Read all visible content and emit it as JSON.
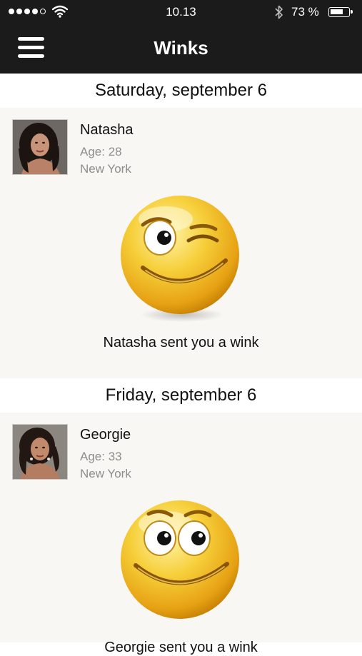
{
  "status_bar": {
    "time": "10.13",
    "battery_percent": "73 %",
    "battery_level": 0.73,
    "signal_icon": "signal-dots-icon",
    "wifi_icon": "wifi-icon",
    "bluetooth_icon": "bluetooth-icon"
  },
  "nav": {
    "title": "Winks",
    "menu_icon": "hamburger-menu-icon"
  },
  "colors": {
    "nav_background": "#1b1b1b",
    "card_background": "#f8f7f3",
    "secondary_text": "#8d8d8d"
  },
  "winks": [
    {
      "date": "Saturday, september 6",
      "name": "Natasha",
      "age": "Age: 28",
      "city": "New York",
      "emoji": "winking-smiley-icon",
      "message": "Natasha sent you a wink"
    },
    {
      "date": "Friday, september 6",
      "name": "Georgie",
      "age": "Age: 33",
      "city": "New York",
      "emoji": "smiling-smiley-icon",
      "message": "Georgie sent you a wink"
    }
  ]
}
